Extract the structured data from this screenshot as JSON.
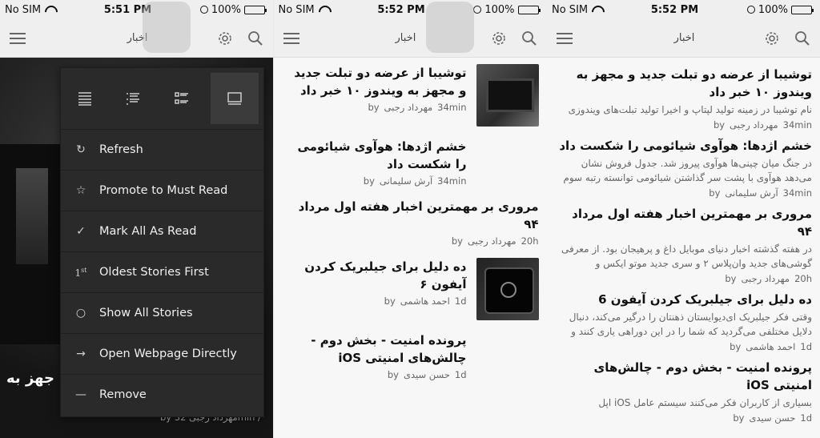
{
  "panels": [
    {
      "status": {
        "carrier": "No SIM",
        "time": "5:51 PM",
        "battery": "100%"
      },
      "title": "اخبار",
      "bottom_headline": "جهز به",
      "bottom_meta": "by مهرداد رجبی 32min /",
      "menu": {
        "items": [
          {
            "icon": "refresh-icon",
            "label": "Refresh"
          },
          {
            "icon": "star-icon",
            "label": "Promote to Must Read"
          },
          {
            "icon": "check-icon",
            "label": "Mark All As Read"
          },
          {
            "icon": "first-order-icon",
            "label": "Oldest Stories First"
          },
          {
            "icon": "circle-icon",
            "label": "Show All Stories"
          },
          {
            "icon": "arrow-right-icon",
            "label": "Open Webpage Directly"
          },
          {
            "icon": "minus-icon",
            "label": "Remove"
          }
        ]
      }
    },
    {
      "status": {
        "carrier": "No SIM",
        "time": "5:52 PM",
        "battery": "100%"
      },
      "title": "اخبار",
      "articles": [
        {
          "headline": "توشیبا از عرضه دو تبلت جدید و مجهز به ویندوز ۱۰ خبر داد",
          "author": "مهرداد رجبی",
          "time": "34min",
          "thumb": "tablet"
        },
        {
          "headline": "خشم اژدها: هوآوی شیائومی را شکست داد",
          "author": "آرش سلیمانی",
          "time": "34min",
          "thumb": ""
        },
        {
          "headline": "مروری بر مهمترین اخبار هفته اول مرداد ۹۴",
          "author": "مهرداد رجبی",
          "time": "20h",
          "thumb": ""
        },
        {
          "headline": "ده دلیل برای جیلبریک کردن آیفون ۶",
          "author": "احمد هاشمی",
          "time": "1d",
          "thumb": "phoneimg"
        },
        {
          "headline": "پرونده امنیت - بخش دوم - چالش‌های امنیتی iOS",
          "author": "حسن سیدی",
          "time": "1d",
          "thumb": ""
        }
      ]
    },
    {
      "status": {
        "carrier": "No SIM",
        "time": "5:52 PM",
        "battery": "100%"
      },
      "title": "اخبار",
      "articles": [
        {
          "headline": "توشیبا از عرضه دو تبلت جدید و مجهز به ویندوز ۱۰ خبر داد",
          "desc": "نام توشیبا در زمینه تولید لپتاپ و اخیرا تولید تبلت‌های ویندوزی",
          "author": "مهرداد رجبی",
          "time": "34min"
        },
        {
          "headline": "خشم اژدها: هوآوی شیائومی را شکست داد",
          "desc": "در جنگ میان چینی‌ها هوآوی پیروز شد. جدول فروش نشان می‌دهد هوآوی با پشت سر گذاشتن شیائومی توانسته رتبه سوم",
          "author": "آرش سلیمانی",
          "time": "34min"
        },
        {
          "headline": "مروری بر مهمترین اخبار هفته اول مرداد ۹۴",
          "desc": "در هفته گذشته اخبار دنیای موبایل داغ و پرهیجان بود. از معرفی گوشی‌های جدید وان‌پلاس ۲ و سری جدید موتو ایکس و",
          "author": "مهرداد رجبی",
          "time": "20h"
        },
        {
          "headline": "ده دلیل برای جیلبریک کردن آیفون 6",
          "desc": "وقتی فکر جیلبریک ای‌دیوایستان ذهنتان را درگیر می‌کند، دنبال دلایل مختلفی می‌گردید که شما را در این دوراهی یاری کنند و",
          "author": "احمد هاشمی",
          "time": "1d"
        },
        {
          "headline": "پرونده امنیت - بخش دوم - چالش‌های امنیتی iOS",
          "desc": "بسیاری از کاربران فکر می‌کنند سیستم عامل iOS اپل",
          "author": "حسن سیدی",
          "time": "1d"
        }
      ]
    }
  ],
  "by_label": "by",
  "icons": {
    "menu": "hamburger-icon",
    "settings": "gear-icon",
    "search": "search-icon"
  }
}
